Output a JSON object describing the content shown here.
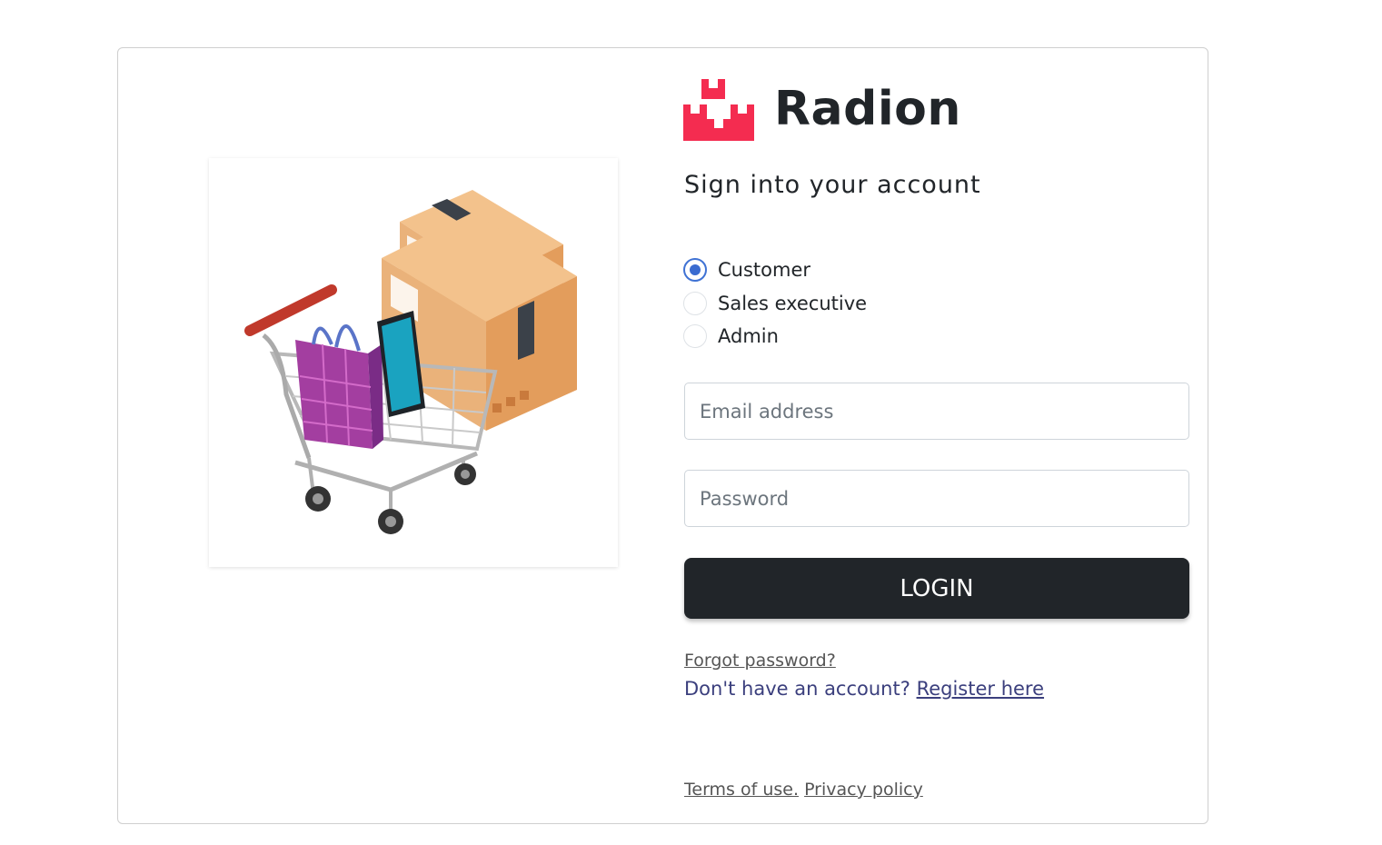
{
  "brand": {
    "name": "Radion",
    "logo_color": "#f42c50"
  },
  "signin": {
    "title": "Sign into your account"
  },
  "roles": {
    "selected": "Customer",
    "options": [
      {
        "label": "Customer",
        "checked": true
      },
      {
        "label": "Sales executive",
        "checked": false
      },
      {
        "label": "Admin",
        "checked": false
      }
    ]
  },
  "form": {
    "email_placeholder": "Email address",
    "email_value": "",
    "password_placeholder": "Password",
    "password_value": "",
    "login_label": "LOGIN"
  },
  "links": {
    "forgot_password": "Forgot password?",
    "no_account_text": "Don't have an account?",
    "register_label": "Register here",
    "terms_label": "Terms of use.",
    "privacy_label": "Privacy policy"
  },
  "illustration": {
    "icon": "shopping-cart-with-boxes-icon"
  },
  "colors": {
    "primary_button": "#212529",
    "radio_checked": "#3a6bd0",
    "link_dark": "#3b3f7d"
  }
}
